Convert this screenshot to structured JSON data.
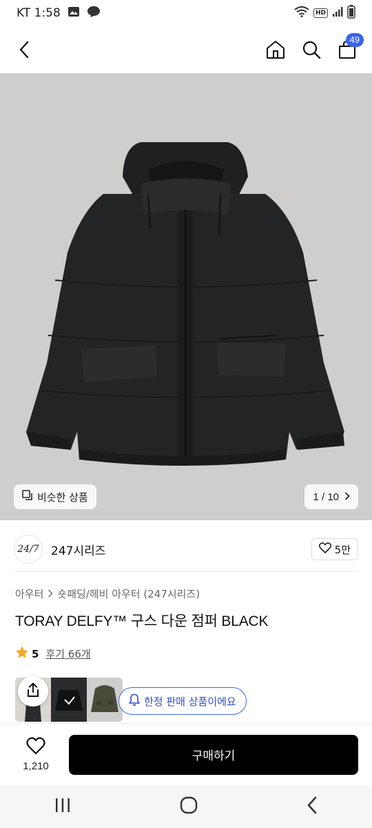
{
  "status_bar": {
    "carrier_time": "KT 1:58",
    "hd_label": "HD",
    "icons": [
      "gallery-icon",
      "chat-bubble-icon",
      "wifi-icon",
      "signal-icon",
      "battery-icon"
    ]
  },
  "top_nav": {
    "icons": [
      "back-arrow-icon",
      "home-icon",
      "search-icon",
      "cart-icon"
    ],
    "cart_count": "49",
    "accent_color": "#3b64ea"
  },
  "hero": {
    "similar_products_label": "비슷한 상품",
    "page_indicator": "1 / 10",
    "background_color": "#cfcecc"
  },
  "brand": {
    "logo_text": "24/7",
    "name": "247시리즈",
    "like_count": "5만"
  },
  "product": {
    "breadcrumb": {
      "category": "아우터",
      "subcategory": "숏패딩/헤비 아우터 (247시리즈)"
    },
    "title": "TORAY DELFY™ 구스 다운 점퍼 BLACK",
    "rating": "5",
    "review_label": "후기 66개",
    "star_color": "#f5a623"
  },
  "limited_badge": {
    "label": "한정 판매 상품이에요"
  },
  "action_bar": {
    "wish_count": "1,210",
    "buy_label": "구매하기"
  },
  "android_nav": {
    "icons": [
      "recent-apps-icon",
      "home-circle-icon",
      "back-chevron-icon"
    ]
  }
}
